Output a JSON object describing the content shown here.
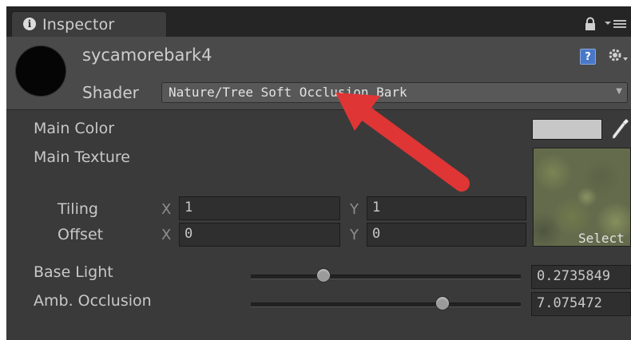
{
  "tab": {
    "label": "Inspector",
    "info_glyph": "i"
  },
  "material": {
    "name": "sycamorebark4",
    "shader_label": "Shader",
    "shader_value": "Nature/Tree Soft Occlusion Bark",
    "help_glyph": "?"
  },
  "properties": {
    "main_color_label": "Main Color",
    "main_color_value": "#c7c7c7",
    "main_texture_label": "Main Texture",
    "tiling": {
      "label": "Tiling",
      "x_axis": "X",
      "y_axis": "Y",
      "x": "1",
      "y": "1"
    },
    "offset": {
      "label": "Offset",
      "x_axis": "X",
      "y_axis": "Y",
      "x": "0",
      "y": "0"
    },
    "texture_select_label": "Select",
    "base_light": {
      "label": "Base Light",
      "value": "0.2735849",
      "slider_fraction": 0.27
    },
    "amb_occlusion": {
      "label": "Amb. Occlusion",
      "value": "7.075472",
      "slider_fraction": 0.71
    }
  },
  "annotation": {
    "arrow_color": "#e03535"
  },
  "icons": [
    "info-icon",
    "lock-icon",
    "tab-menu-icon",
    "help-icon",
    "gear-icon",
    "eyedropper-icon",
    "dropdown-arrow-icon"
  ]
}
